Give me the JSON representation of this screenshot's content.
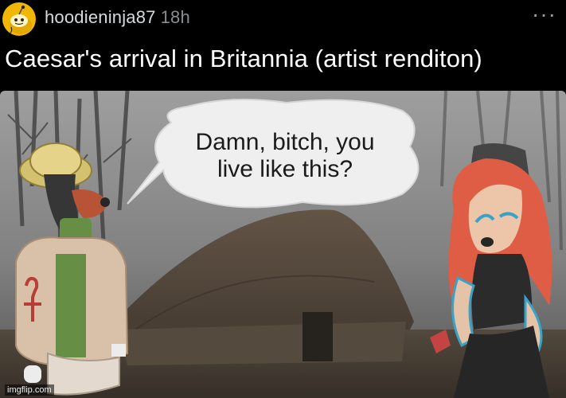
{
  "post": {
    "username": "hoodieninja87",
    "time": "18h",
    "more_label": "···",
    "title": "Caesar's arrival in Britannia (artist renditon)"
  },
  "meme": {
    "speech_line1": "Damn, bitch, you",
    "speech_line2": "live like this?",
    "watermark": "imgflip.com"
  },
  "icons": {
    "avatar": "reddit-snoo-avatar-icon",
    "more": "more-options-icon"
  },
  "colors": {
    "background": "#000000",
    "username": "#d7dadc",
    "time": "#8a8d90",
    "avatar_bg": "#f2b705"
  }
}
